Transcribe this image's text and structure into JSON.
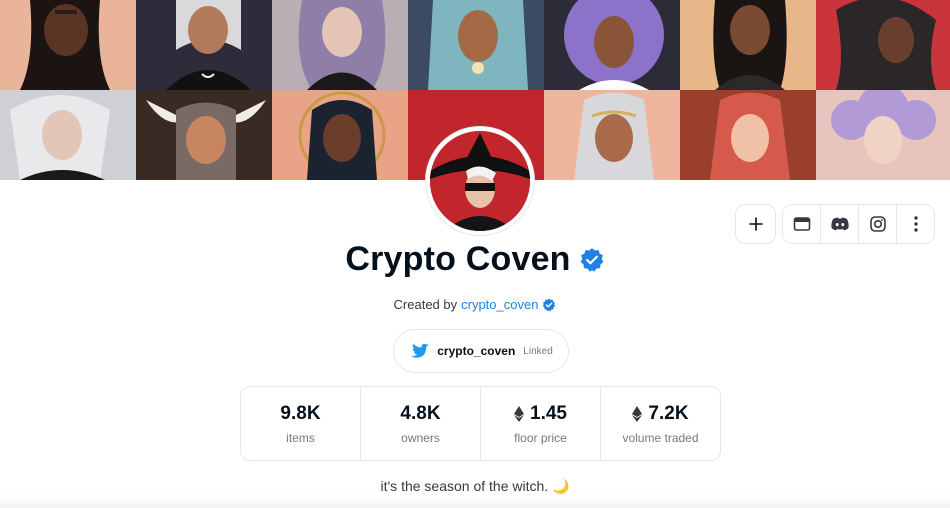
{
  "collection": {
    "name": "Crypto Coven",
    "created_by_prefix": "Created by",
    "creator": "crypto_coven",
    "description": "it's the season of the witch.",
    "description_emoji": "🌙"
  },
  "social": {
    "twitter_handle": "crypto_coven",
    "twitter_status": "Linked"
  },
  "actions": [
    {
      "name": "add-button",
      "icon": "plus-icon"
    },
    {
      "name": "website-button",
      "icon": "browser-window-icon"
    },
    {
      "name": "discord-button",
      "icon": "discord-icon"
    },
    {
      "name": "instagram-button",
      "icon": "instagram-icon"
    },
    {
      "name": "more-button",
      "icon": "more-vertical-icon"
    }
  ],
  "stats": [
    {
      "value": "9.8K",
      "label": "items",
      "eth": false
    },
    {
      "value": "4.8K",
      "label": "owners",
      "eth": false
    },
    {
      "value": "1.45",
      "label": "floor price",
      "eth": true
    },
    {
      "value": "7.2K",
      "label": "volume traded",
      "eth": true
    }
  ],
  "colors": {
    "accent_blue": "#2081e2",
    "verified_blue": "#2081e2",
    "twitter_blue": "#1d9bf0",
    "text_primary": "#04111d",
    "text_secondary": "#707a83"
  }
}
